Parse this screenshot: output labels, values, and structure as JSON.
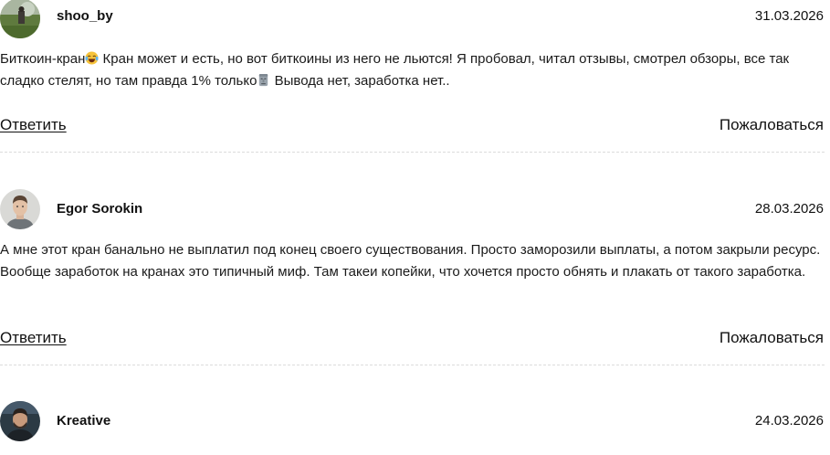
{
  "comments": [
    {
      "author": "shoo_by",
      "date": "31.03.2026",
      "text_part1": "Биткоин-кран",
      "emoji1": "laughing-crying-emoji",
      "text_part2": " Кран может и есть, но вот биткоины из него не льются! Я пробовал, читал отзывы, смотрел обзоры, все так сладко стелят, но там правда 1% только",
      "emoji2": "moai-emoji",
      "text_part3": " Вывода нет, заработка нет..",
      "reply_label": "Ответить",
      "report_label": "Пожаловаться"
    },
    {
      "author": "Egor Sorokin",
      "date": "28.03.2026",
      "text": "А мне этот кран банально не выплатил под конец своего существования. Просто заморозили выплаты, а потом закрыли ресурс. Вообще заработок на кранах это типичный миф. Там такеи копейки, что хочется просто обнять и плакать от такого заработка.",
      "reply_label": "Ответить",
      "report_label": "Пожаловаться"
    },
    {
      "author": "Kreative",
      "date": "24.03.2026"
    }
  ]
}
